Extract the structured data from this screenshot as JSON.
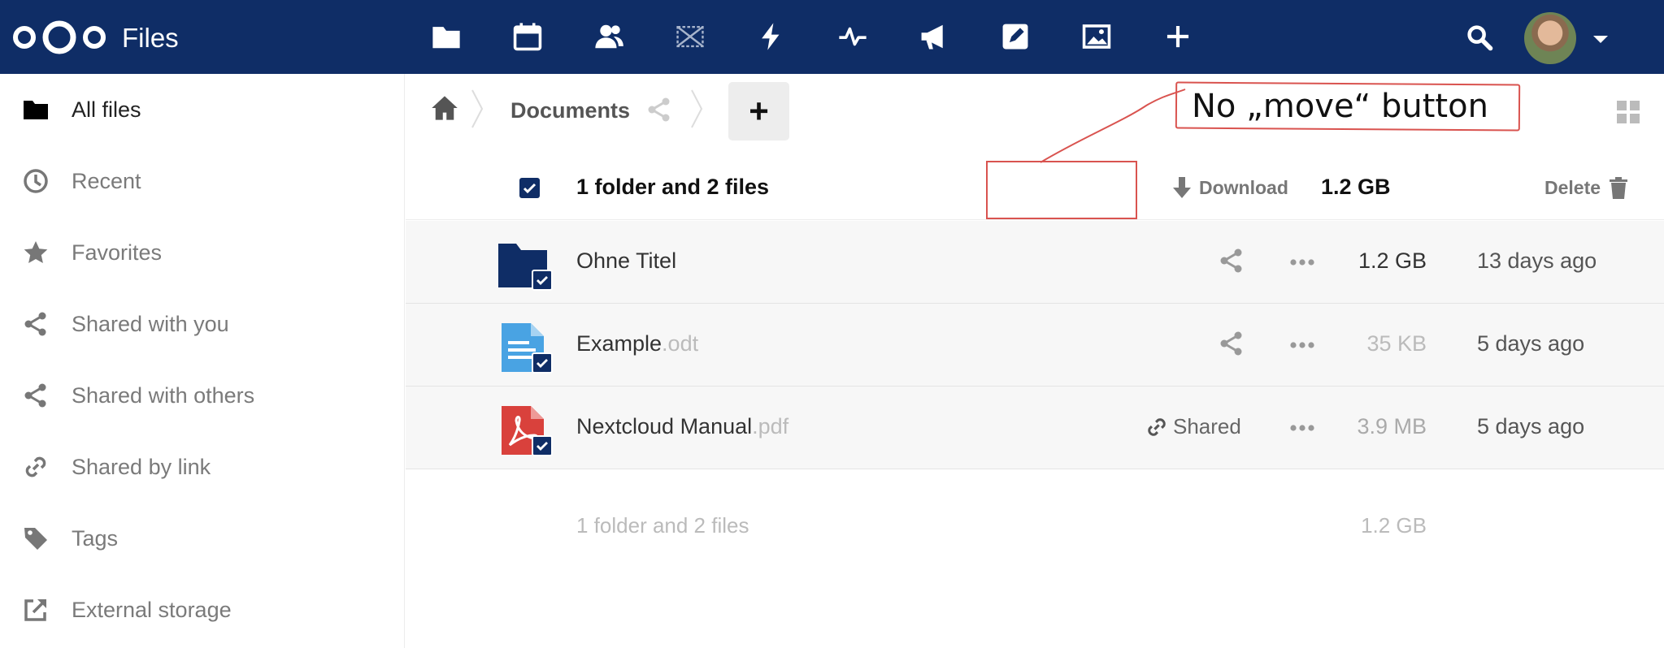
{
  "header": {
    "app_name": "Files",
    "apps": [
      {
        "name": "files-icon"
      },
      {
        "name": "calendar-icon"
      },
      {
        "name": "contacts-icon"
      },
      {
        "name": "gallery-crossed-icon"
      },
      {
        "name": "activity-bolt-icon"
      },
      {
        "name": "monitoring-icon"
      },
      {
        "name": "announcement-icon"
      },
      {
        "name": "notes-edit-icon"
      },
      {
        "name": "photos-icon"
      },
      {
        "name": "more-apps-plus-icon"
      }
    ],
    "colors": {
      "bar": "#0f2d66",
      "icon": "#ffffff"
    }
  },
  "sidebar": {
    "items": [
      {
        "label": "All files",
        "icon": "folder-icon",
        "active": true
      },
      {
        "label": "Recent",
        "icon": "clock-icon",
        "active": false
      },
      {
        "label": "Favorites",
        "icon": "star-icon",
        "active": false
      },
      {
        "label": "Shared with you",
        "icon": "share-icon",
        "active": false
      },
      {
        "label": "Shared with others",
        "icon": "share-icon",
        "active": false
      },
      {
        "label": "Shared by link",
        "icon": "link-icon",
        "active": false
      },
      {
        "label": "Tags",
        "icon": "tag-icon",
        "active": false
      },
      {
        "label": "External storage",
        "icon": "external-link-icon",
        "active": false
      }
    ]
  },
  "breadcrumb": {
    "current": "Documents",
    "new_button": "+"
  },
  "selection": {
    "summary": "1 folder and 2 files",
    "download_label": "Download",
    "size": "1.2 GB",
    "delete_label": "Delete"
  },
  "files": [
    {
      "name": "Ohne Titel",
      "ext": "",
      "type": "folder",
      "action": "share",
      "size": "1.2 GB",
      "size_color": "#333333",
      "mtime": "13 days ago"
    },
    {
      "name": "Example",
      "ext": ".odt",
      "type": "document",
      "action": "share",
      "size": "35 KB",
      "size_color": "#bbbbbb",
      "mtime": "5 days ago"
    },
    {
      "name": "Nextcloud Manual",
      "ext": ".pdf",
      "type": "pdf",
      "action": "Shared",
      "size": "3.9 MB",
      "size_color": "#aaaaaa",
      "mtime": "5 days ago"
    }
  ],
  "footer_summary": {
    "text": "1 folder and 2 files",
    "size": "1.2 GB"
  },
  "annotation": {
    "text": "No „move“ button",
    "color": "#d9534f"
  }
}
